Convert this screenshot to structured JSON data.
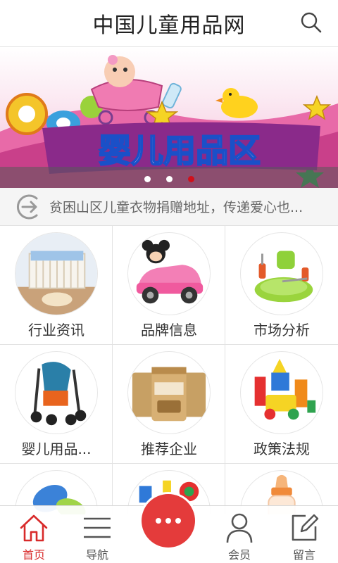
{
  "header": {
    "title": "中国儿童用品网"
  },
  "banner": {
    "text": "婴儿用品区",
    "slide_count": 3,
    "active_slide": 3
  },
  "notice": {
    "text": "贫困山区儿童衣物捐赠地址，传递爱心也..."
  },
  "grid": {
    "items": [
      {
        "label": "行业资讯",
        "icon": "crib-image"
      },
      {
        "label": "品牌信息",
        "icon": "toy-car-image"
      },
      {
        "label": "市场分析",
        "icon": "baby-dishes-image"
      },
      {
        "label": "婴儿用品...",
        "icon": "stroller-image"
      },
      {
        "label": "推荐企业",
        "icon": "milk-powder-image"
      },
      {
        "label": "政策法规",
        "icon": "building-blocks-image"
      },
      {
        "label": "",
        "icon": "pacifier-image"
      },
      {
        "label": "",
        "icon": "stacking-toys-image"
      },
      {
        "label": "",
        "icon": "baby-bottle-image"
      }
    ]
  },
  "nav": {
    "home": "首页",
    "guide": "导航",
    "member": "会员",
    "message": "留言",
    "center_icon": "more-dots-icon"
  },
  "colors": {
    "accent": "#d82a2a",
    "center_button": "#e43b3b",
    "active_dot": "#d0101b"
  }
}
